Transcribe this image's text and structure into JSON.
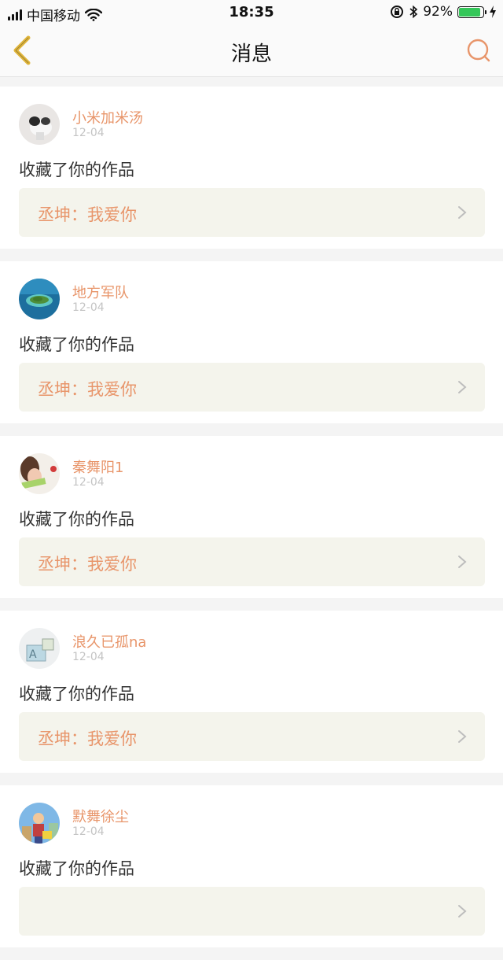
{
  "status_bar": {
    "carrier": "中国移动",
    "time": "18:35",
    "battery": "92%",
    "battery_level": 0.92
  },
  "nav": {
    "title": "消息",
    "back_icon": "chevron-left-icon",
    "search_icon": "search-icon"
  },
  "messages": [
    {
      "username": "小米加米汤",
      "date": "12-04",
      "action": "收藏了你的作品",
      "work": "丞坤：我爱你",
      "avatar_icon": "avatar-dog-photo"
    },
    {
      "username": "地方军队",
      "date": "12-04",
      "action": "收藏了你的作品",
      "work": "丞坤：我爱你",
      "avatar_icon": "avatar-island-photo"
    },
    {
      "username": "秦舞阳1",
      "date": "12-04",
      "action": "收藏了你的作品",
      "work": "丞坤：我爱你",
      "avatar_icon": "avatar-girl-photo"
    },
    {
      "username": "浪久已孤na",
      "date": "12-04",
      "action": "收藏了你的作品",
      "work": "丞坤：我爱你",
      "avatar_icon": "avatar-sketch-photo"
    },
    {
      "username": "默舞徐尘",
      "date": "12-04",
      "action": "收藏了你的作品",
      "work": "",
      "avatar_icon": "avatar-cartoon-photo"
    }
  ],
  "colors": {
    "accent": "#e8956a",
    "back_icon": "#e0b53a",
    "work_box_bg": "#f4f4ec"
  }
}
